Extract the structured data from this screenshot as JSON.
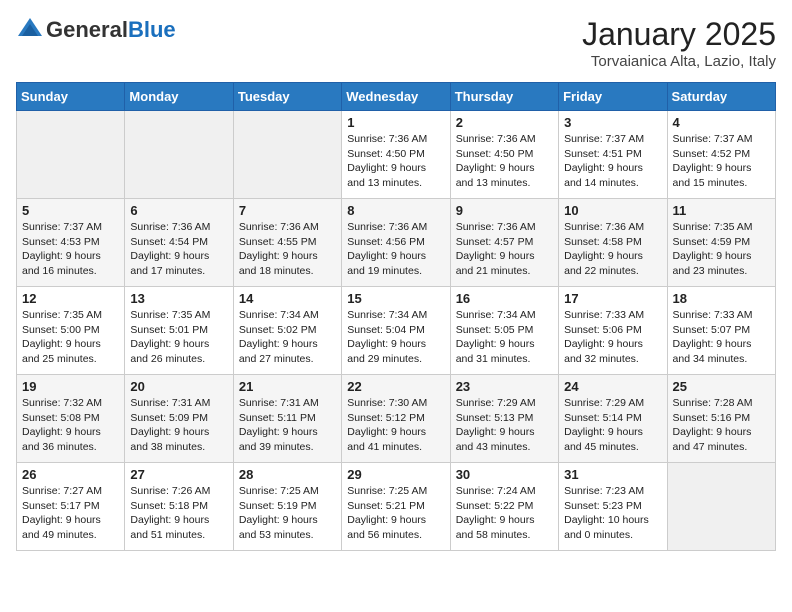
{
  "header": {
    "logo_general": "General",
    "logo_blue": "Blue",
    "month_title": "January 2025",
    "location": "Torvaianica Alta, Lazio, Italy"
  },
  "days_of_week": [
    "Sunday",
    "Monday",
    "Tuesday",
    "Wednesday",
    "Thursday",
    "Friday",
    "Saturday"
  ],
  "weeks": [
    [
      {
        "day": "",
        "info": ""
      },
      {
        "day": "",
        "info": ""
      },
      {
        "day": "",
        "info": ""
      },
      {
        "day": "1",
        "info": "Sunrise: 7:36 AM\nSunset: 4:50 PM\nDaylight: 9 hours\nand 13 minutes."
      },
      {
        "day": "2",
        "info": "Sunrise: 7:36 AM\nSunset: 4:50 PM\nDaylight: 9 hours\nand 13 minutes."
      },
      {
        "day": "3",
        "info": "Sunrise: 7:37 AM\nSunset: 4:51 PM\nDaylight: 9 hours\nand 14 minutes."
      },
      {
        "day": "4",
        "info": "Sunrise: 7:37 AM\nSunset: 4:52 PM\nDaylight: 9 hours\nand 15 minutes."
      }
    ],
    [
      {
        "day": "5",
        "info": "Sunrise: 7:37 AM\nSunset: 4:53 PM\nDaylight: 9 hours\nand 16 minutes."
      },
      {
        "day": "6",
        "info": "Sunrise: 7:36 AM\nSunset: 4:54 PM\nDaylight: 9 hours\nand 17 minutes."
      },
      {
        "day": "7",
        "info": "Sunrise: 7:36 AM\nSunset: 4:55 PM\nDaylight: 9 hours\nand 18 minutes."
      },
      {
        "day": "8",
        "info": "Sunrise: 7:36 AM\nSunset: 4:56 PM\nDaylight: 9 hours\nand 19 minutes."
      },
      {
        "day": "9",
        "info": "Sunrise: 7:36 AM\nSunset: 4:57 PM\nDaylight: 9 hours\nand 21 minutes."
      },
      {
        "day": "10",
        "info": "Sunrise: 7:36 AM\nSunset: 4:58 PM\nDaylight: 9 hours\nand 22 minutes."
      },
      {
        "day": "11",
        "info": "Sunrise: 7:35 AM\nSunset: 4:59 PM\nDaylight: 9 hours\nand 23 minutes."
      }
    ],
    [
      {
        "day": "12",
        "info": "Sunrise: 7:35 AM\nSunset: 5:00 PM\nDaylight: 9 hours\nand 25 minutes."
      },
      {
        "day": "13",
        "info": "Sunrise: 7:35 AM\nSunset: 5:01 PM\nDaylight: 9 hours\nand 26 minutes."
      },
      {
        "day": "14",
        "info": "Sunrise: 7:34 AM\nSunset: 5:02 PM\nDaylight: 9 hours\nand 27 minutes."
      },
      {
        "day": "15",
        "info": "Sunrise: 7:34 AM\nSunset: 5:04 PM\nDaylight: 9 hours\nand 29 minutes."
      },
      {
        "day": "16",
        "info": "Sunrise: 7:34 AM\nSunset: 5:05 PM\nDaylight: 9 hours\nand 31 minutes."
      },
      {
        "day": "17",
        "info": "Sunrise: 7:33 AM\nSunset: 5:06 PM\nDaylight: 9 hours\nand 32 minutes."
      },
      {
        "day": "18",
        "info": "Sunrise: 7:33 AM\nSunset: 5:07 PM\nDaylight: 9 hours\nand 34 minutes."
      }
    ],
    [
      {
        "day": "19",
        "info": "Sunrise: 7:32 AM\nSunset: 5:08 PM\nDaylight: 9 hours\nand 36 minutes."
      },
      {
        "day": "20",
        "info": "Sunrise: 7:31 AM\nSunset: 5:09 PM\nDaylight: 9 hours\nand 38 minutes."
      },
      {
        "day": "21",
        "info": "Sunrise: 7:31 AM\nSunset: 5:11 PM\nDaylight: 9 hours\nand 39 minutes."
      },
      {
        "day": "22",
        "info": "Sunrise: 7:30 AM\nSunset: 5:12 PM\nDaylight: 9 hours\nand 41 minutes."
      },
      {
        "day": "23",
        "info": "Sunrise: 7:29 AM\nSunset: 5:13 PM\nDaylight: 9 hours\nand 43 minutes."
      },
      {
        "day": "24",
        "info": "Sunrise: 7:29 AM\nSunset: 5:14 PM\nDaylight: 9 hours\nand 45 minutes."
      },
      {
        "day": "25",
        "info": "Sunrise: 7:28 AM\nSunset: 5:16 PM\nDaylight: 9 hours\nand 47 minutes."
      }
    ],
    [
      {
        "day": "26",
        "info": "Sunrise: 7:27 AM\nSunset: 5:17 PM\nDaylight: 9 hours\nand 49 minutes."
      },
      {
        "day": "27",
        "info": "Sunrise: 7:26 AM\nSunset: 5:18 PM\nDaylight: 9 hours\nand 51 minutes."
      },
      {
        "day": "28",
        "info": "Sunrise: 7:25 AM\nSunset: 5:19 PM\nDaylight: 9 hours\nand 53 minutes."
      },
      {
        "day": "29",
        "info": "Sunrise: 7:25 AM\nSunset: 5:21 PM\nDaylight: 9 hours\nand 56 minutes."
      },
      {
        "day": "30",
        "info": "Sunrise: 7:24 AM\nSunset: 5:22 PM\nDaylight: 9 hours\nand 58 minutes."
      },
      {
        "day": "31",
        "info": "Sunrise: 7:23 AM\nSunset: 5:23 PM\nDaylight: 10 hours\nand 0 minutes."
      },
      {
        "day": "",
        "info": ""
      }
    ]
  ]
}
